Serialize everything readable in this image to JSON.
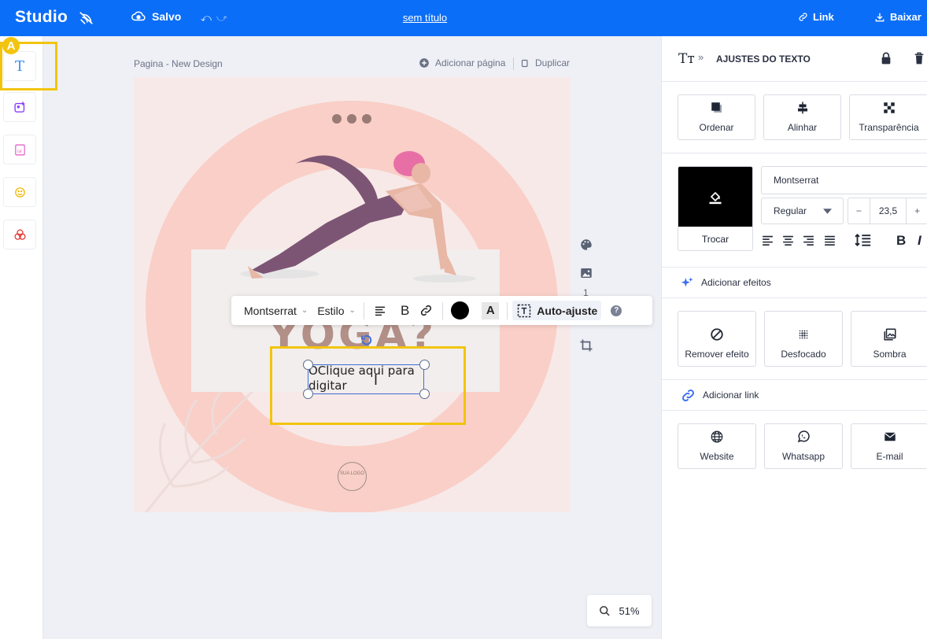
{
  "topbar": {
    "logo": "Studio",
    "saved_label": "Salvo",
    "doc_title": "sem título",
    "link_label": "Link",
    "download_label": "Baixar"
  },
  "annotation": {
    "badge": "A"
  },
  "canvas": {
    "page_label": "Pagina - New Design",
    "add_page_label": "Adicionar página",
    "duplicate_label": "Duplicar",
    "page_count": "1"
  },
  "design": {
    "headline": "YOGA?",
    "text_placeholder": "OClique aqui para digitar",
    "logo_text": "SUA LOGO"
  },
  "text_toolbar": {
    "font": "Montserrat",
    "style": "Estilo",
    "autofit_label": "Auto-ajuste",
    "help": "?"
  },
  "zoom": {
    "value": "51%"
  },
  "panel": {
    "title": "AJUSTES DO TEXTO",
    "actions": [
      "Ordenar",
      "Alinhar",
      "Transparência"
    ],
    "swap_label": "Trocar",
    "font_name": "Montserrat",
    "font_weight": "Regular",
    "font_size": "23,5",
    "minus": "−",
    "plus": "+",
    "bold": "B",
    "italic": "I",
    "effects_label": "Adicionar efeitos",
    "effects": [
      "Remover efeito",
      "Desfocado",
      "Sombra"
    ],
    "link_label": "Adicionar link",
    "links": [
      "Website",
      "Whatsapp",
      "E-mail"
    ]
  },
  "colors": {
    "brand": "#0b6ef8",
    "highlight": "#f2c40e",
    "text_color": "#000000"
  }
}
